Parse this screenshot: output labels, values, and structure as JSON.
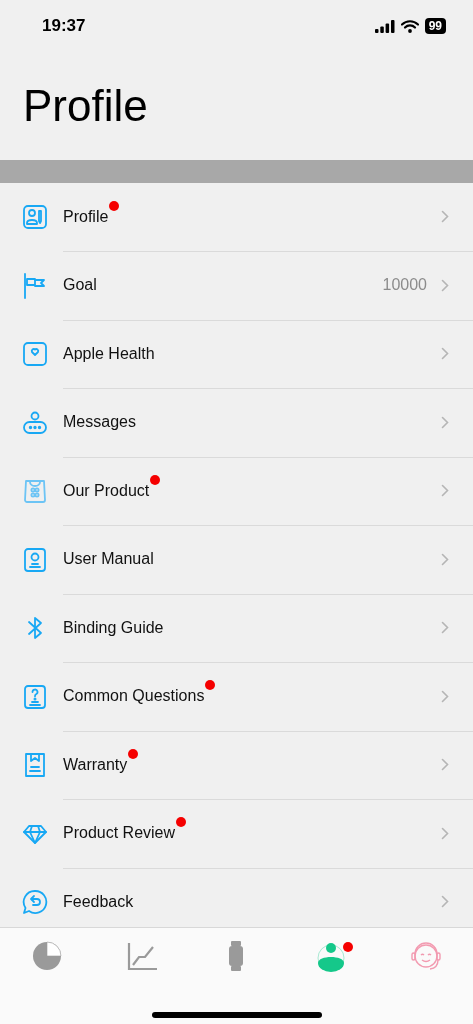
{
  "status_bar": {
    "time": "19:37",
    "battery": "99"
  },
  "title": "Profile",
  "items": [
    {
      "label": "Profile",
      "badge": true
    },
    {
      "label": "Goal",
      "badge": false,
      "value": "10000"
    },
    {
      "label": "Apple Health",
      "badge": false
    },
    {
      "label": "Messages",
      "badge": false
    },
    {
      "label": "Our Product",
      "badge": true
    },
    {
      "label": "User Manual",
      "badge": false
    },
    {
      "label": "Binding Guide",
      "badge": false
    },
    {
      "label": "Common Questions",
      "badge": true
    },
    {
      "label": "Warranty",
      "badge": true
    },
    {
      "label": "Product Review",
      "badge": true
    },
    {
      "label": "Feedback",
      "badge": false
    }
  ],
  "tab_bar": [
    {
      "selected": false,
      "badge": false
    },
    {
      "selected": false,
      "badge": false
    },
    {
      "selected": false,
      "badge": false
    },
    {
      "selected": true,
      "badge": true
    },
    {
      "selected": false,
      "badge": false
    }
  ]
}
